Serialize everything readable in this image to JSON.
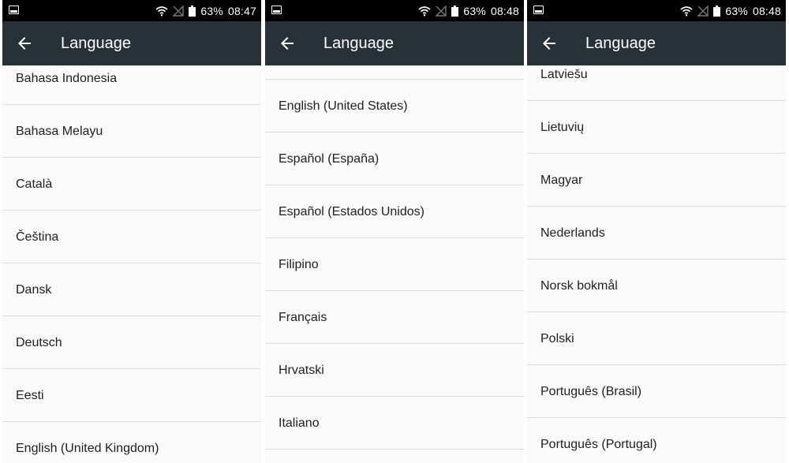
{
  "screens": [
    {
      "status": {
        "battery": "63%",
        "time": "08:47"
      },
      "app_bar": {
        "title": "Language"
      },
      "items": [
        {
          "label": "Bahasa Indonesia"
        },
        {
          "label": "Bahasa Melayu"
        },
        {
          "label": "Català"
        },
        {
          "label": "Čeština"
        },
        {
          "label": "Dansk"
        },
        {
          "label": "Deutsch"
        },
        {
          "label": "Eesti"
        },
        {
          "label": "English (United Kingdom)"
        }
      ]
    },
    {
      "status": {
        "battery": "63%",
        "time": "08:48"
      },
      "app_bar": {
        "title": "Language"
      },
      "items": [
        {
          "label": ""
        },
        {
          "label": "English (United States)"
        },
        {
          "label": "Español (España)"
        },
        {
          "label": "Español (Estados Unidos)"
        },
        {
          "label": "Filipino"
        },
        {
          "label": "Français"
        },
        {
          "label": "Hrvatski"
        },
        {
          "label": "Italiano"
        }
      ]
    },
    {
      "status": {
        "battery": "63%",
        "time": "08:48"
      },
      "app_bar": {
        "title": "Language"
      },
      "items": [
        {
          "label": "Latviešu"
        },
        {
          "label": "Lietuvių"
        },
        {
          "label": "Magyar"
        },
        {
          "label": "Nederlands"
        },
        {
          "label": "Norsk bokmål"
        },
        {
          "label": "Polski"
        },
        {
          "label": "Português (Brasil)"
        },
        {
          "label": "Português (Portugal)"
        }
      ]
    }
  ],
  "colors": {
    "status_bar": "#000000",
    "app_bar": "#263238",
    "list_background": "#fafafa",
    "divider": "#dcdcdc",
    "text": "#212121"
  },
  "icons": {
    "back": "arrow-left-icon",
    "wifi": "wifi-icon",
    "no_signal": "no-signal-icon",
    "battery": "battery-icon",
    "notification": "image-notification-icon"
  }
}
